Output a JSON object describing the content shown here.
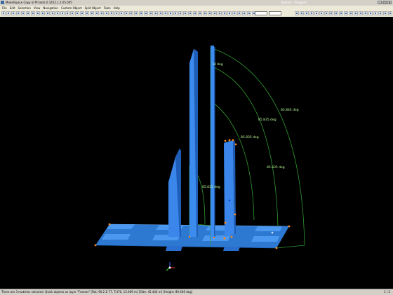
{
  "window": {
    "title": "ModelSpace Copy of PI.tests 0.1452.1.2.05.005",
    "buttons": [
      "_",
      "□",
      "×"
    ]
  },
  "menu": [
    "File",
    "Edit",
    "Selection",
    "View",
    "Navigation",
    "Custom Object",
    "Split Object",
    "Tools",
    "Help"
  ],
  "side_panel_title": "Options - Viewport",
  "viewport": {
    "angle_labels": [
      "14 deg",
      "85.835 deg",
      "85.835 deg",
      "85.844 deg",
      "85.835 deg",
      "85.835 deg"
    ]
  },
  "status": {
    "text": "There are 3 matches selected. Quick objects on layer \"Frames\" [Rot: 90.2 Z 77, T:476, 15.069 m] [Side: 45.440 m] [Height: 89.406 deg]",
    "right": "1 / 2"
  },
  "colors": {
    "accent": "#3c8cf0",
    "grid": "#2f7fdc",
    "arc": "#2f9a2f",
    "handle": "#ff8a20",
    "label": "#bfff9a"
  }
}
